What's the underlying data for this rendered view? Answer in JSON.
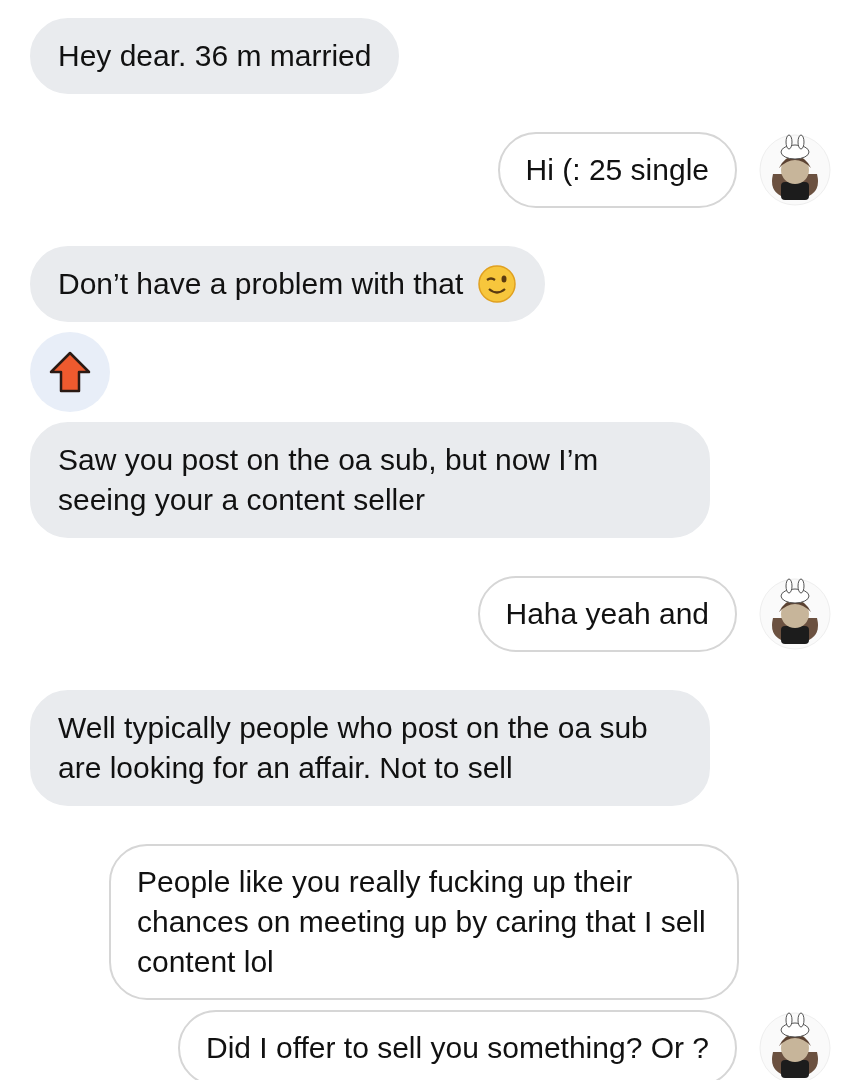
{
  "messages": [
    {
      "kind": "received",
      "text": "Hey dear. 36 m married"
    },
    {
      "kind": "sent",
      "text": "Hi (: 25 single",
      "avatar": true
    },
    {
      "kind": "received",
      "text": "Don’t have a problem with that",
      "winking": true
    },
    {
      "kind": "reaction"
    },
    {
      "kind": "received",
      "text": "Saw you post on the oa sub, but now I’m seeing your a content seller"
    },
    {
      "kind": "sent",
      "text": "Haha yeah and",
      "avatar": true
    },
    {
      "kind": "received",
      "text": "Well typically people who post on the oa sub are looking for an affair. Not to sell"
    },
    {
      "kind": "sent",
      "text": "People like you really fucking up their chances on meeting up by caring that I sell content lol",
      "avatar": false
    },
    {
      "kind": "sent",
      "text": "Did I offer to sell you something? Or ?",
      "avatar": true
    }
  ]
}
